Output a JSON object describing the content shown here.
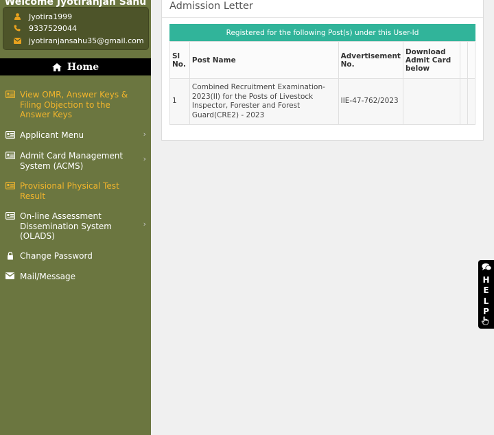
{
  "sidebar": {
    "welcome": "Welcome Jyotiranjan Sahu",
    "user": {
      "username": "Jyotira1999",
      "phone": "9337529044",
      "email": "jyotiranjansahu35@gmail.com"
    },
    "home_label": "Home",
    "menu": [
      {
        "label": "View OMR, Answer Keys & Filing Objection to the Answer Keys",
        "icon": "id-card-icon",
        "highlight": true
      },
      {
        "label": "Applicant Menu",
        "icon": "id-card-icon",
        "chevron": true
      },
      {
        "label": "Admit Card Management System (ACMS)",
        "icon": "id-card-icon",
        "chevron": true
      },
      {
        "label": "Provisional Physical Test Result",
        "icon": "id-card-icon",
        "highlight": true
      },
      {
        "label": "On-line Assessment Dissemination System (OLADS)",
        "icon": "id-card-icon",
        "chevron": true
      },
      {
        "label": "Change Password",
        "icon": "lock-icon"
      },
      {
        "label": "Mail/Message",
        "icon": "envelope-icon"
      }
    ]
  },
  "main": {
    "title": "Admission Letter",
    "subheader": "Registered for the following Post(s) under this User-Id",
    "columns": [
      "Sl No.",
      "Post Name",
      "Advertisement No.",
      "Download Admit Card below",
      "",
      ""
    ],
    "rows": [
      {
        "sl": "1",
        "post": "Combined Recruitment Examination-2023(II) for the Posts of Livestock Inspector, Forester and Forest Guard(CRE2) - 2023",
        "adv": "IIE-47-762/2023",
        "download": "",
        "c5": "",
        "c6": ""
      }
    ]
  },
  "help": {
    "letters": [
      "H",
      "E",
      "L",
      "P"
    ]
  },
  "colors": {
    "sidebar_bg": "#6b7640",
    "user_box_bg": "#4d5429",
    "accent_orange": "#f2b52c",
    "table_header_green": "#31b49a"
  }
}
